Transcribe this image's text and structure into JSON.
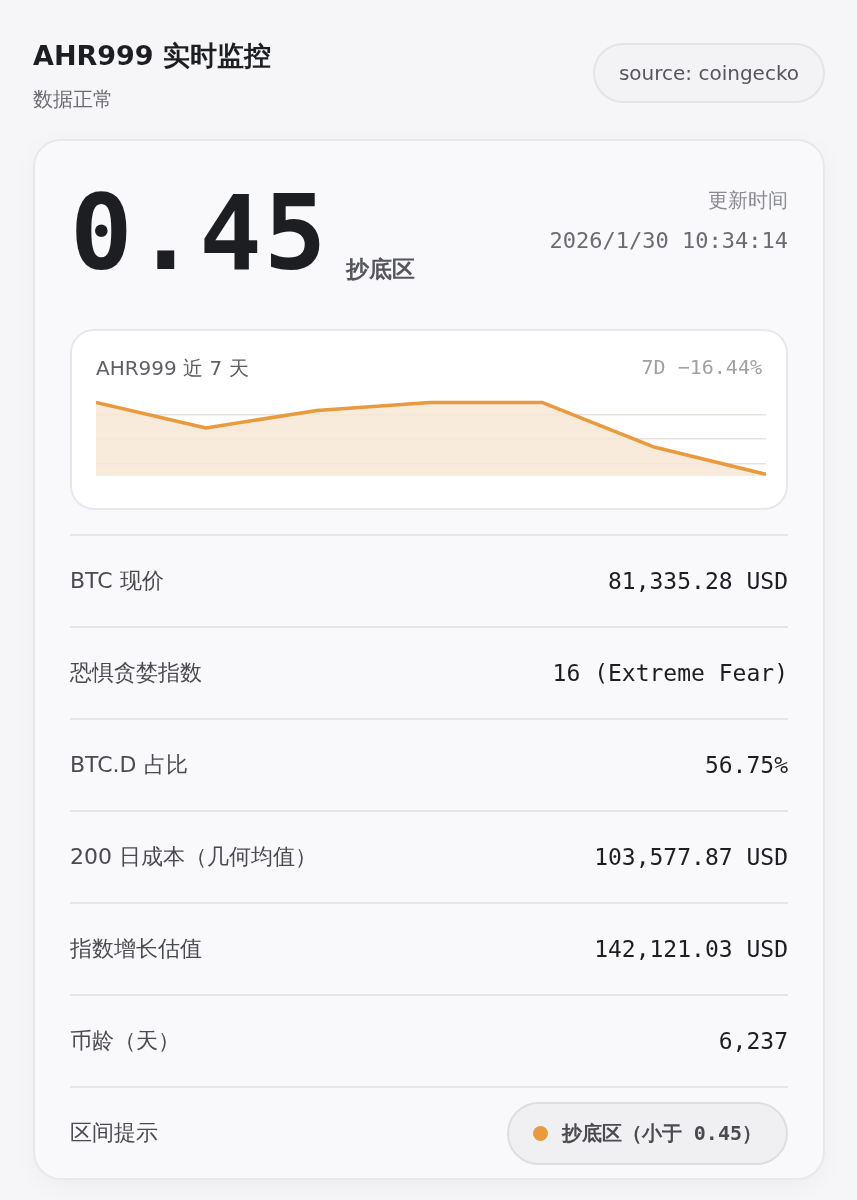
{
  "header": {
    "title": "AHR999 实时监控",
    "status": "数据正常",
    "source": "source: coingecko"
  },
  "summary": {
    "value": "0.45",
    "zone": "抄底区",
    "updated_label": "更新时间",
    "updated_time": "2026/1/30 10:34:14"
  },
  "trend": {
    "title": "AHR999 近 7 天",
    "change": "7D −16.44%"
  },
  "metrics": [
    {
      "kind": "text",
      "label": "BTC 现价",
      "value": "81,335.28 USD"
    },
    {
      "kind": "text",
      "label": "恐惧贪婪指数",
      "value": "16 (Extreme Fear)"
    },
    {
      "kind": "text",
      "label": "BTC.D 占比",
      "value": "56.75%"
    },
    {
      "kind": "text",
      "label": "200 日成本（几何均值）",
      "value": "103,577.87 USD"
    },
    {
      "kind": "text",
      "label": "指数增长估值",
      "value": "142,121.03 USD"
    },
    {
      "kind": "text",
      "label": "币龄（天）",
      "value": "6,237"
    },
    {
      "kind": "badge",
      "label": "区间提示",
      "value": "抄底区（小于 0.45）"
    }
  ]
}
